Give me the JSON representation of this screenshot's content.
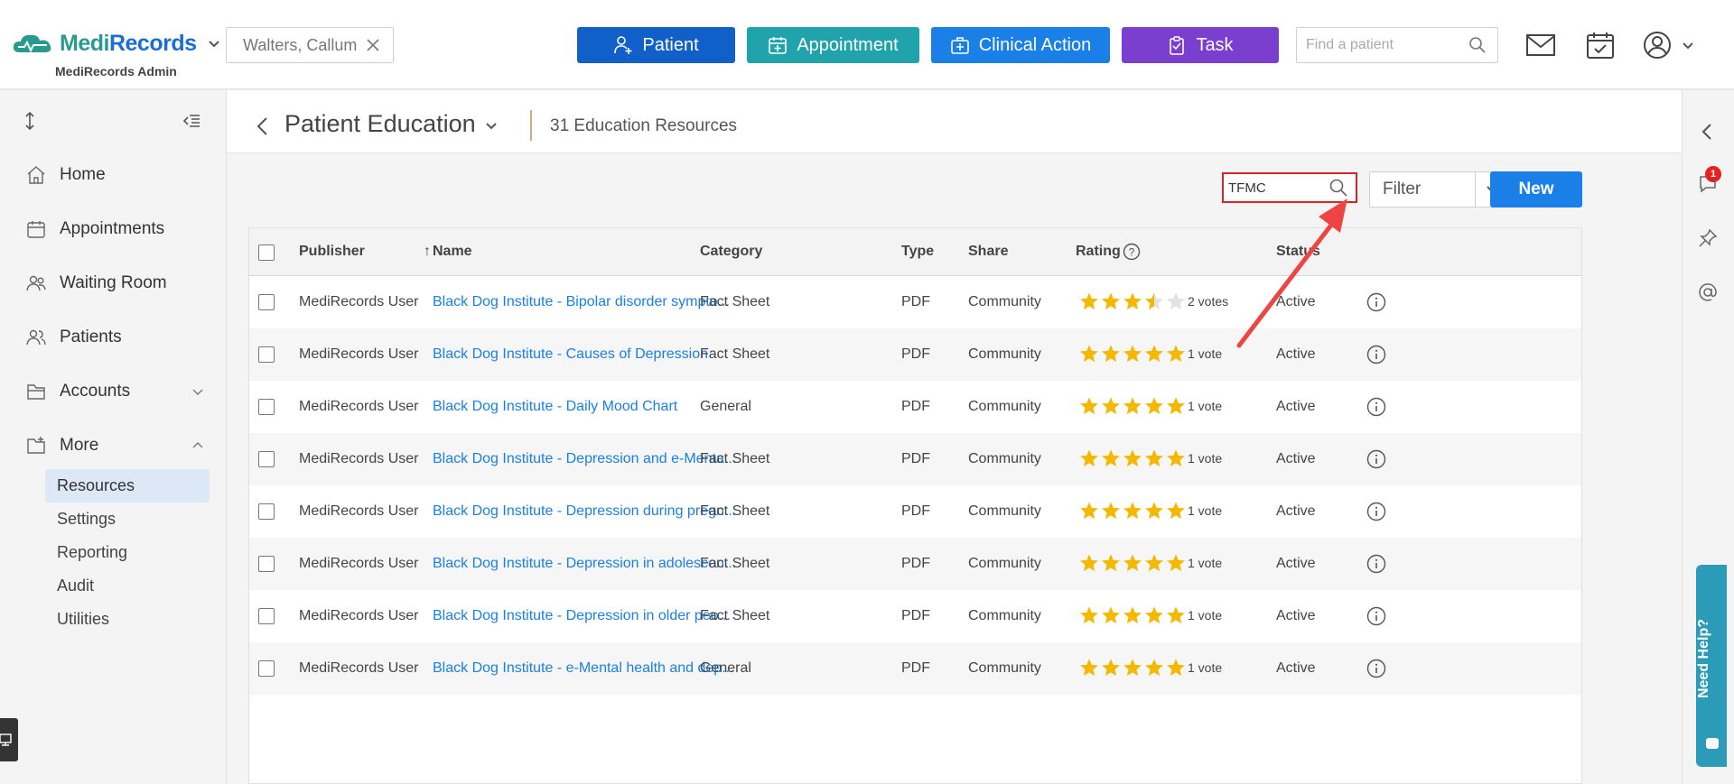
{
  "header": {
    "logo_medi": "Medi",
    "logo_records": "Records",
    "admin_label": "MediRecords Admin",
    "patient_chip": "Walters, Callum",
    "buttons": {
      "patient": "Patient",
      "appointment": "Appointment",
      "clinical_action": "Clinical Action",
      "task": "Task"
    },
    "find_patient_placeholder": "Find a patient"
  },
  "sidebar": {
    "items": [
      {
        "label": "Home"
      },
      {
        "label": "Appointments"
      },
      {
        "label": "Waiting Room"
      },
      {
        "label": "Patients"
      },
      {
        "label": "Accounts"
      },
      {
        "label": "More"
      }
    ],
    "sub_items": [
      {
        "label": "Resources",
        "active": true
      },
      {
        "label": "Settings"
      },
      {
        "label": "Reporting"
      },
      {
        "label": "Audit"
      },
      {
        "label": "Utilities"
      }
    ]
  },
  "main": {
    "title": "Patient Education",
    "count_label": "31 Education Resources",
    "search_value": "TFMC",
    "filter_label": "Filter",
    "new_label": "New",
    "columns": {
      "publisher": "Publisher",
      "name": "Name",
      "sort_arrow": "↑",
      "category": "Category",
      "type": "Type",
      "share": "Share",
      "rating": "Rating",
      "status": "Status"
    },
    "rows": [
      {
        "publisher": "MediRecords User",
        "name": "Black Dog Institute - Bipolar disorder sympto...",
        "category": "Fact Sheet",
        "type": "PDF",
        "share": "Community",
        "rating": 3.5,
        "votes": "2 votes",
        "status": "Active"
      },
      {
        "publisher": "MediRecords User",
        "name": "Black Dog Institute - Causes of Depression",
        "category": "Fact Sheet",
        "type": "PDF",
        "share": "Community",
        "rating": 5,
        "votes": "1 vote",
        "status": "Active"
      },
      {
        "publisher": "MediRecords User",
        "name": "Black Dog Institute - Daily Mood Chart",
        "category": "General",
        "type": "PDF",
        "share": "Community",
        "rating": 5,
        "votes": "1 vote",
        "status": "Active"
      },
      {
        "publisher": "MediRecords User",
        "name": "Black Dog Institute - Depression and e-Menta...",
        "category": "Fact Sheet",
        "type": "PDF",
        "share": "Community",
        "rating": 5,
        "votes": "1 vote",
        "status": "Active"
      },
      {
        "publisher": "MediRecords User",
        "name": "Black Dog Institute - Depression during pregn...",
        "category": "Fact Sheet",
        "type": "PDF",
        "share": "Community",
        "rating": 5,
        "votes": "1 vote",
        "status": "Active"
      },
      {
        "publisher": "MediRecords User",
        "name": "Black Dog Institute - Depression in adolescen...",
        "category": "Fact Sheet",
        "type": "PDF",
        "share": "Community",
        "rating": 5,
        "votes": "1 vote",
        "status": "Active"
      },
      {
        "publisher": "MediRecords User",
        "name": "Black Dog Institute - Depression in older peo...",
        "category": "Fact Sheet",
        "type": "PDF",
        "share": "Community",
        "rating": 5,
        "votes": "1 vote",
        "status": "Active"
      },
      {
        "publisher": "MediRecords User",
        "name": "Black Dog Institute - e-Mental health and dep...",
        "category": "General",
        "type": "PDF",
        "share": "Community",
        "rating": 5,
        "votes": "1 vote",
        "status": "Active"
      }
    ],
    "notification_count": "1",
    "need_help": "Need Help?"
  },
  "colors": {
    "primary_blue": "#1a7fe6",
    "patient_blue": "#1160c9",
    "teal": "#20a3ab",
    "purple": "#7a3fcf",
    "star": "#f5b800",
    "highlight_red": "#d9232a"
  }
}
